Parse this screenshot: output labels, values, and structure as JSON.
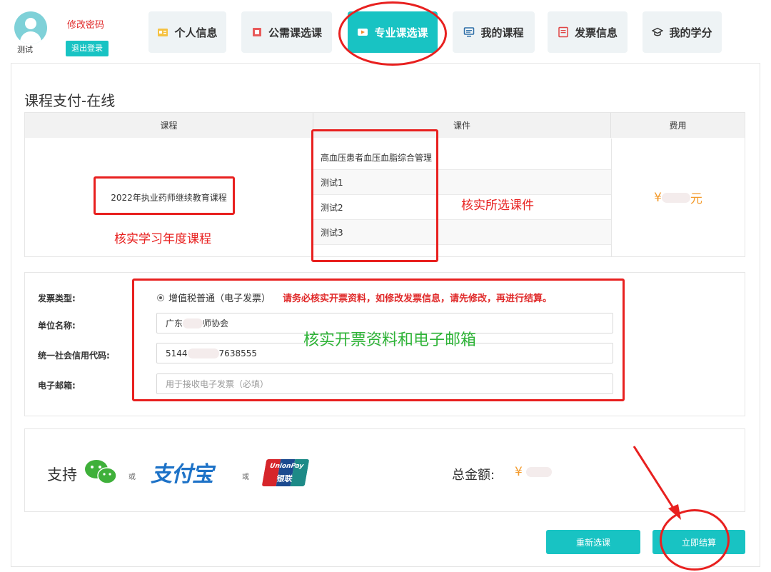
{
  "header": {
    "username": "测试",
    "change_password": "修改密码",
    "logout": "退出登录",
    "tabs": [
      {
        "label": "个人信息",
        "icon": "id-card-icon"
      },
      {
        "label": "公需课选课",
        "icon": "book-icon"
      },
      {
        "label": "专业课选课",
        "icon": "video-icon"
      },
      {
        "label": "我的课程",
        "icon": "monitor-icon"
      },
      {
        "label": "发票信息",
        "icon": "invoice-icon"
      },
      {
        "label": "我的学分",
        "icon": "graduation-cap-icon"
      }
    ],
    "active_tab": "专业课选课"
  },
  "page": {
    "title": "课程支付-在线"
  },
  "course_table": {
    "headers": [
      "课程",
      "课件",
      "费用"
    ],
    "course": "2022年执业药师继续教育课程",
    "coursewares": [
      "高血压患者血压血脂综合管理",
      "测试1",
      "测试2",
      "测试3"
    ],
    "fee_prefix": "¥",
    "fee_suffix": "元"
  },
  "invoice": {
    "type_label": "发票类型:",
    "type_option": "增值税普通（电子发票）",
    "warning": "请务必核实开票资料，如修改发票信息，请先修改，再进行结算。",
    "company_label": "单位名称:",
    "company_value_start": "广东",
    "company_value_end": "师协会",
    "credit_code_label": "统一社会信用代码:",
    "credit_code_start": "5144",
    "credit_code_end": "7638555",
    "email_label": "电子邮箱:",
    "email_placeholder": "用于接收电子发票（必填）"
  },
  "payment": {
    "support_label": "支持",
    "or_label": "或",
    "methods": [
      "wechat-pay-icon",
      "alipay-logo",
      "unionpay-logo"
    ],
    "alipay_text": "支付宝",
    "unionpay_text_top": "UnionPay",
    "unionpay_text_bottom": "银联",
    "total_label": "总金额:",
    "total_prefix": "¥"
  },
  "buttons": {
    "reselect": "重新选课",
    "checkout": "立即结算"
  },
  "annotations": {
    "check_course": "核实学习年度课程",
    "check_courseware": "核实所选课件",
    "check_invoice": "核实开票资料和电子邮箱"
  },
  "colors": {
    "accent": "#18c3c3",
    "annotation_red": "#e8201f",
    "annotation_green": "#2db336",
    "fee_orange": "#f39a2b"
  }
}
